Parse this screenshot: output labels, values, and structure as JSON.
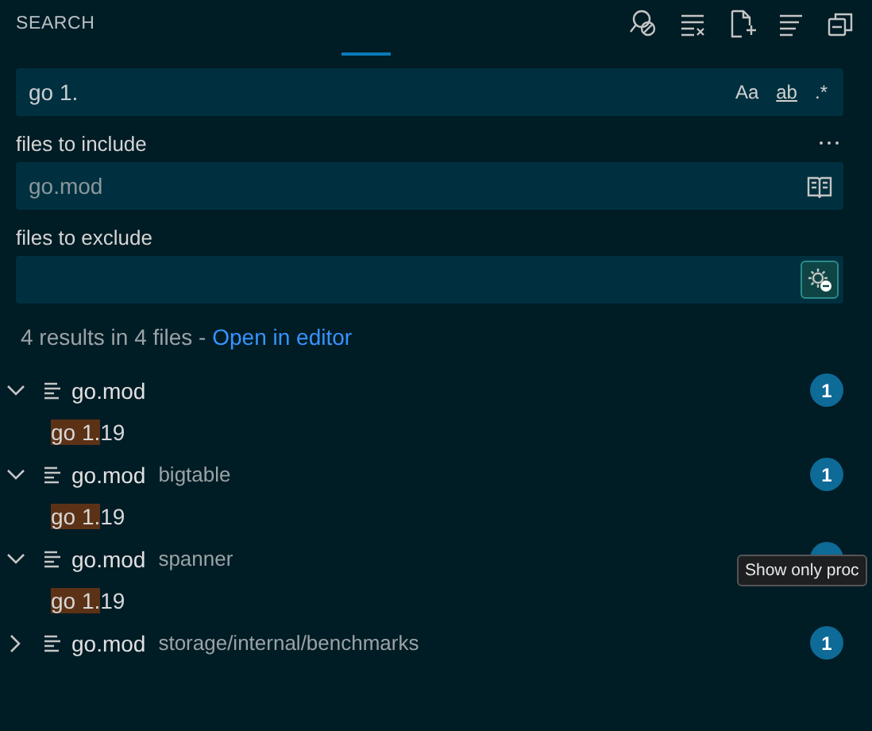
{
  "panel": {
    "title": "SEARCH"
  },
  "search": {
    "value": "go 1.",
    "toggles": [
      {
        "label": "Aa",
        "selected": false
      },
      {
        "label": "ab",
        "selected": false
      },
      {
        "label": ".*",
        "selected": false
      }
    ]
  },
  "include": {
    "label": "files to include",
    "value": "go.mod"
  },
  "exclude": {
    "label": "files to exclude",
    "use_settings": {
      "selected": true
    }
  },
  "summary": {
    "text": "4 results in 4 files - ",
    "link": "Open in editor"
  },
  "results": [
    {
      "file": "go.mod",
      "expanded": true,
      "count": "1",
      "matches": [
        {
          "highlight": "go 1.",
          "rest": "19"
        }
      ]
    },
    {
      "file": "go.mod",
      "path": "bigtable",
      "expanded": true,
      "count": "1",
      "matches": [
        {
          "highlight": "go 1.",
          "rest": "19"
        }
      ]
    },
    {
      "file": "go.mod",
      "path": "spanner",
      "expanded": true,
      "matches": [
        {
          "highlight": "go 1.",
          "rest": "19"
        }
      ]
    },
    {
      "file": "go.mod",
      "path": "storage/internal/benchmarks",
      "expanded": false,
      "count": "1"
    }
  ],
  "tooltip": {
    "text": "Show only proc"
  }
}
